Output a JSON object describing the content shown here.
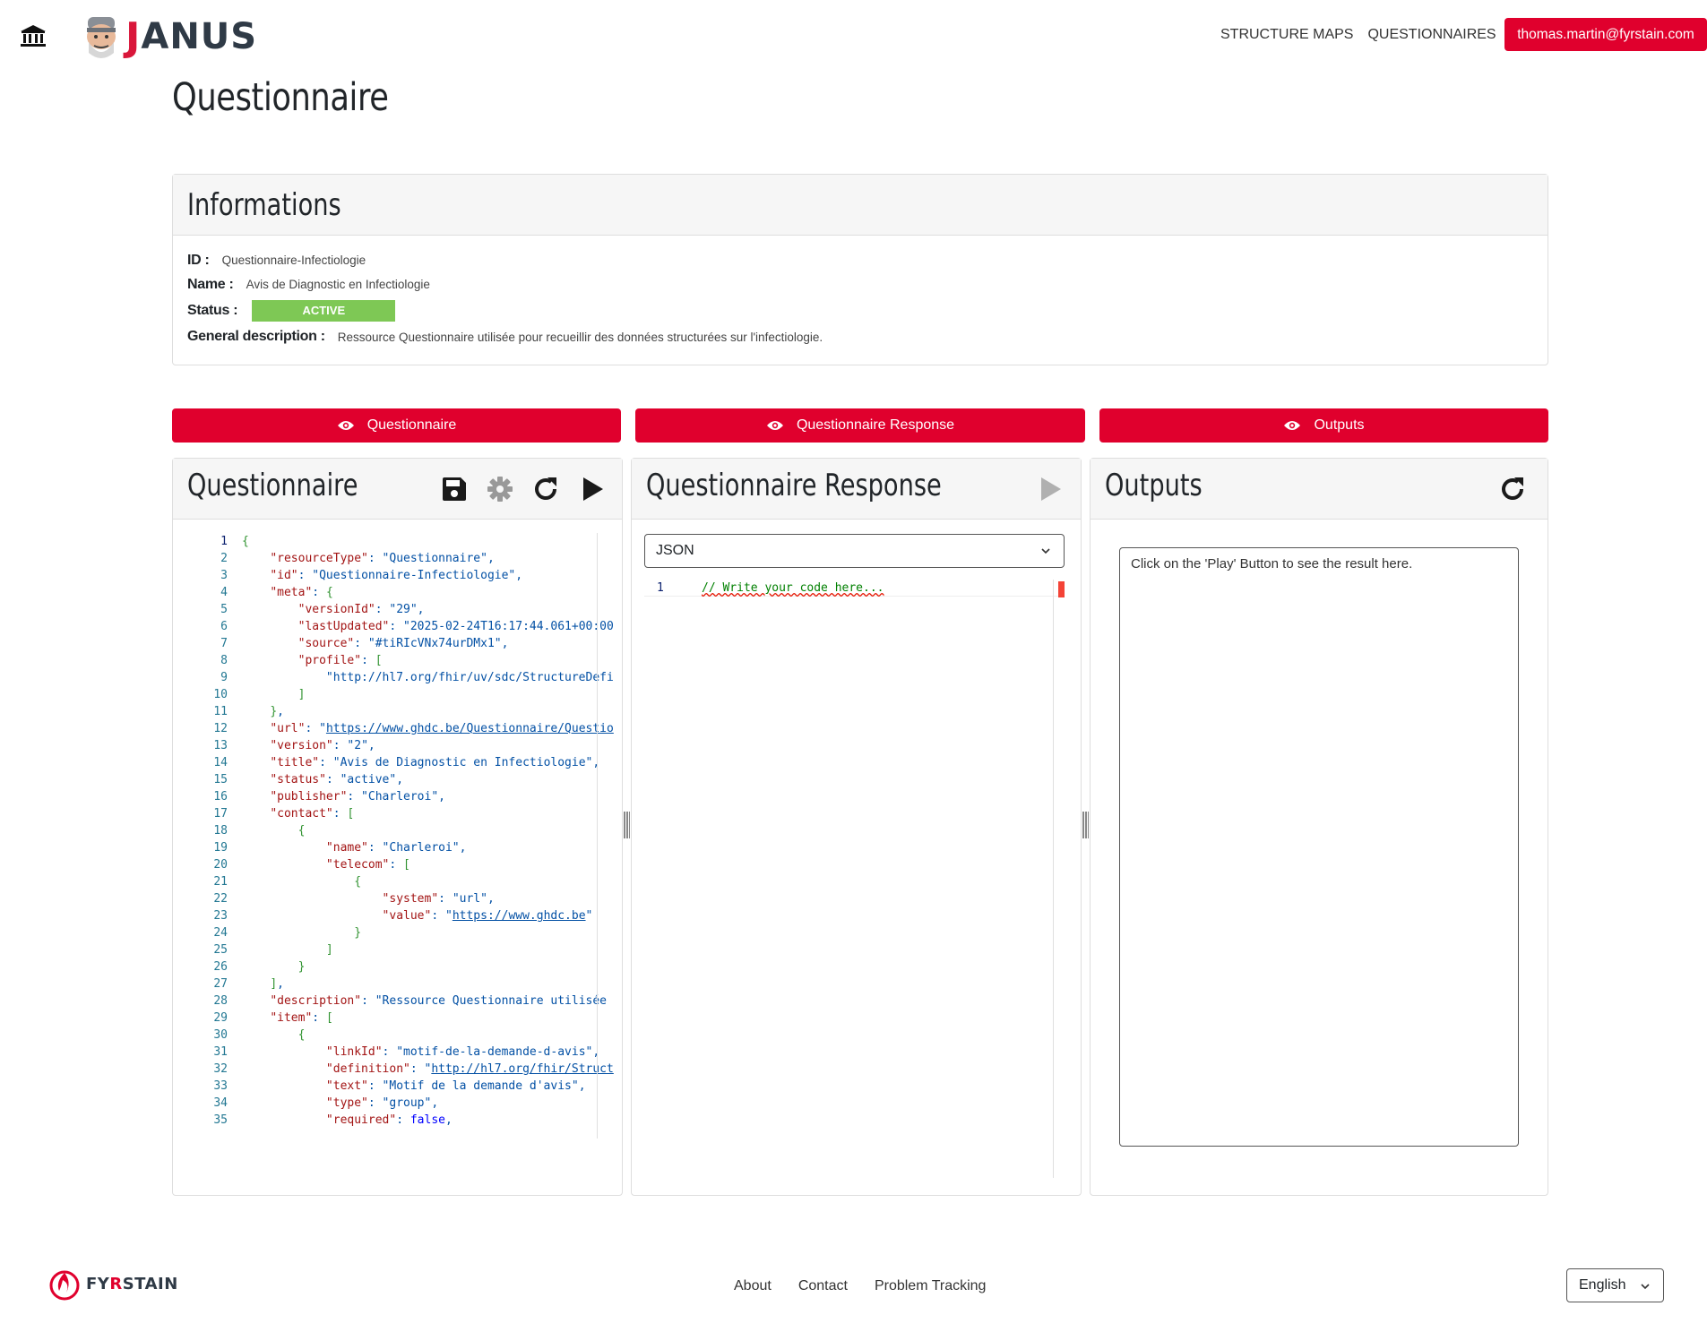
{
  "nav": {
    "links": [
      "STRUCTURE MAPS",
      "QUESTIONNAIRES"
    ],
    "user_email": "thomas.martin@fyrstain.com",
    "logo_text": "JANUS"
  },
  "page": {
    "title": "Questionnaire"
  },
  "info": {
    "title": "Informations",
    "id_label": "ID :",
    "id_value": "Questionnaire-Infectiologie",
    "name_label": "Name :",
    "name_value": "Avis de Diagnostic en Infectiologie",
    "status_label": "Status :",
    "status_value": "ACTIVE",
    "status_color": "#7ec855",
    "description_label": "General description :",
    "description_value": "Ressource Questionnaire utilisée pour recueillir des données structurées sur l'infectiologie."
  },
  "toggles": [
    "Questionnaire",
    "Questionnaire Response",
    "Outputs"
  ],
  "panels": {
    "questionnaire": {
      "title": "Questionnaire",
      "icons": [
        "save-icon",
        "gear-icon",
        "refresh-icon",
        "play-icon"
      ]
    },
    "response": {
      "title": "Questionnaire Response",
      "format": "JSON",
      "placeholder": "// Write your code here...",
      "line_number": "1"
    },
    "outputs": {
      "title": "Outputs",
      "placeholder": "Click on the 'Play' Button to see the result here."
    }
  },
  "code_lines": [
    "{",
    "    \"resourceType\": \"Questionnaire\",",
    "    \"id\": \"Questionnaire-Infectiologie\",",
    "    \"meta\": {",
    "        \"versionId\": \"29\",",
    "        \"lastUpdated\": \"2025-02-24T16:17:44.061+00:00",
    "        \"source\": \"#tiRIcVNx74urDMx1\",",
    "        \"profile\": [",
    "            \"http://hl7.org/fhir/uv/sdc/StructureDefi",
    "        ]",
    "    },",
    "    \"url\": \"https://www.ghdc.be/Questionnaire/Questio",
    "    \"version\": \"2\",",
    "    \"title\": \"Avis de Diagnostic en Infectiologie\",",
    "    \"status\": \"active\",",
    "    \"publisher\": \"Charleroi\",",
    "    \"contact\": [",
    "        {",
    "            \"name\": \"Charleroi\",",
    "            \"telecom\": [",
    "                {",
    "                    \"system\": \"url\",",
    "                    \"value\": \"https://www.ghdc.be\"",
    "                }",
    "            ]",
    "        }",
    "    ],",
    "    \"description\": \"Ressource Questionnaire utilisée",
    "    \"item\": [",
    "        {",
    "            \"linkId\": \"motif-de-la-demande-d-avis\",",
    "            \"definition\": \"http://hl7.org/fhir/Struct",
    "            \"text\": \"Motif de la demande d'avis\",",
    "            \"type\": \"group\",",
    "            \"required\": false,"
  ],
  "footer": {
    "brand": "FYRSTAIN",
    "links": [
      "About",
      "Contact",
      "Problem Tracking"
    ],
    "language": "English"
  },
  "colors": {
    "accent": "#e0002d",
    "status": "#7ec855"
  }
}
